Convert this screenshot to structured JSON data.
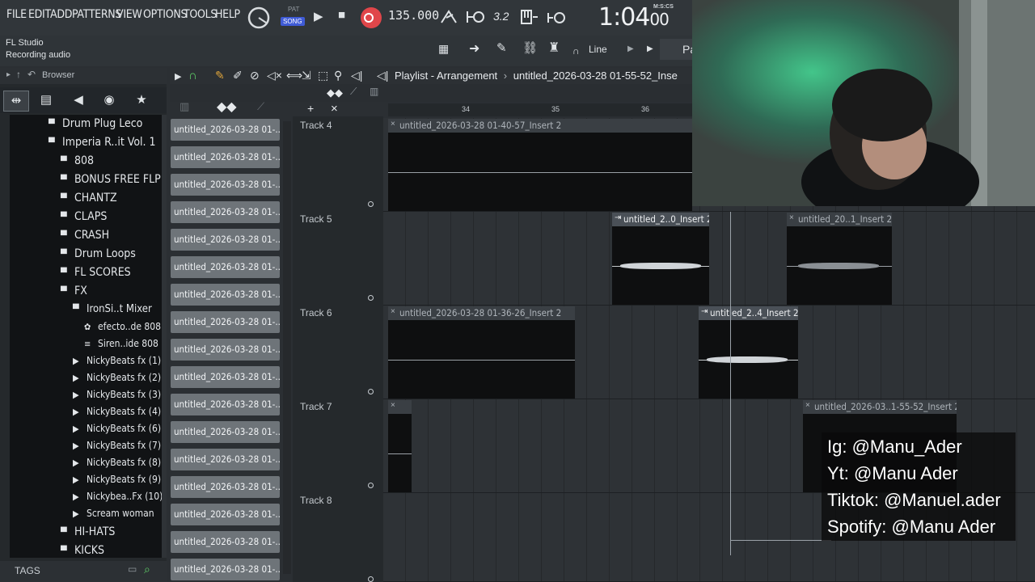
{
  "menu": {
    "file": "FILE",
    "edit": "EDIT",
    "add": "ADD",
    "patterns": "PATTERNS",
    "view": "VIEW",
    "options": "OPTIONS",
    "tools": "TOOLS",
    "help": "HELP"
  },
  "transport": {
    "pat_label": "PAT",
    "song_label": "SONG",
    "tempo": "135.000",
    "time_main": "1:04",
    "time_sub": "00",
    "time_format": "M:S:CS",
    "pitch_label": "3.2"
  },
  "window": {
    "app_name": "FL Studio",
    "status": "Recording audio"
  },
  "toolbar2": {
    "snap_mode": "Line",
    "pattern_label": "Pa"
  },
  "browser": {
    "label": "Browser",
    "tags_label": "TAGS",
    "tree": [
      {
        "label": "Drum Plug Leco"
      },
      {
        "label": "Imperia R..it Vol. 1"
      },
      {
        "label": "808"
      },
      {
        "label": "BONUS FREE FLP"
      },
      {
        "label": "CHANTZ"
      },
      {
        "label": "CLAPS"
      },
      {
        "label": "CRASH"
      },
      {
        "label": "Drum Loops"
      },
      {
        "label": "FL SCORES"
      },
      {
        "label": "FX"
      },
      {
        "label": "IronSi..t Mixer"
      },
      {
        "label": "efecto..de 808"
      },
      {
        "label": "Siren..ide 808"
      },
      {
        "label": "NickyBeats fx (1)"
      },
      {
        "label": "NickyBeats fx (2)"
      },
      {
        "label": "NickyBeats fx (3)"
      },
      {
        "label": "NickyBeats fx (4)"
      },
      {
        "label": "NickyBeats fx (6)"
      },
      {
        "label": "NickyBeats fx (7)"
      },
      {
        "label": "NickyBeats fx (8)"
      },
      {
        "label": "NickyBeats fx (9)"
      },
      {
        "label": "Nickybea..Fx (10)"
      },
      {
        "label": "Scream woman"
      },
      {
        "label": "HI-HATS"
      },
      {
        "label": "KICKS"
      }
    ]
  },
  "channels": [
    "untitled_2026-03-28 01-...",
    "untitled_2026-03-28 01-...",
    "untitled_2026-03-28 01-...",
    "untitled_2026-03-28 01-...",
    "untitled_2026-03-28 01-...",
    "untitled_2026-03-28 01-...",
    "untitled_2026-03-28 01-...",
    "untitled_2026-03-28 01-...",
    "untitled_2026-03-28 01-...",
    "untitled_2026-03-28 01-...",
    "untitled_2026-03-28 01-...",
    "untitled_2026-03-28 01-...",
    "untitled_2026-03-28 01-...",
    "untitled_2026-03-28 01-...",
    "untitled_2026-03-28 01-...",
    "untitled_2026-03-28 01-...",
    "untitled_2026-03-28 01-..."
  ],
  "playlist": {
    "title": "Playlist - Arrangement",
    "project": "untitled_2026-03-28 01-55-52_Inse",
    "ruler": [
      "34",
      "35",
      "36"
    ],
    "tracks": [
      "Track 4",
      "Track 5",
      "Track 6",
      "Track 7",
      "Track 8"
    ],
    "clips": {
      "t4a": "untitled_2026-03-28 01-40-57_Insert 2",
      "t5a": "untitled_2..0_Insert 2",
      "t5b": "untitled_20..1_Insert 2",
      "t6a": "untitled_2026-03-28 01-36-26_Insert 2",
      "t6b": "untitled_2..4_Insert 2",
      "t7b": "untitled_2026-03..1-55-52_Insert 2"
    }
  },
  "overlay": {
    "ig": "Ig: @Manu_Ader",
    "yt": "Yt: @Manu Ader",
    "tiktok": "Tiktok: @Manuel.ader",
    "spotify": "Spotify: @Manu Ader"
  },
  "colors": {
    "record": "#e0464a",
    "accent_blue": "#3f5bd6",
    "background": "#2b2f33"
  }
}
